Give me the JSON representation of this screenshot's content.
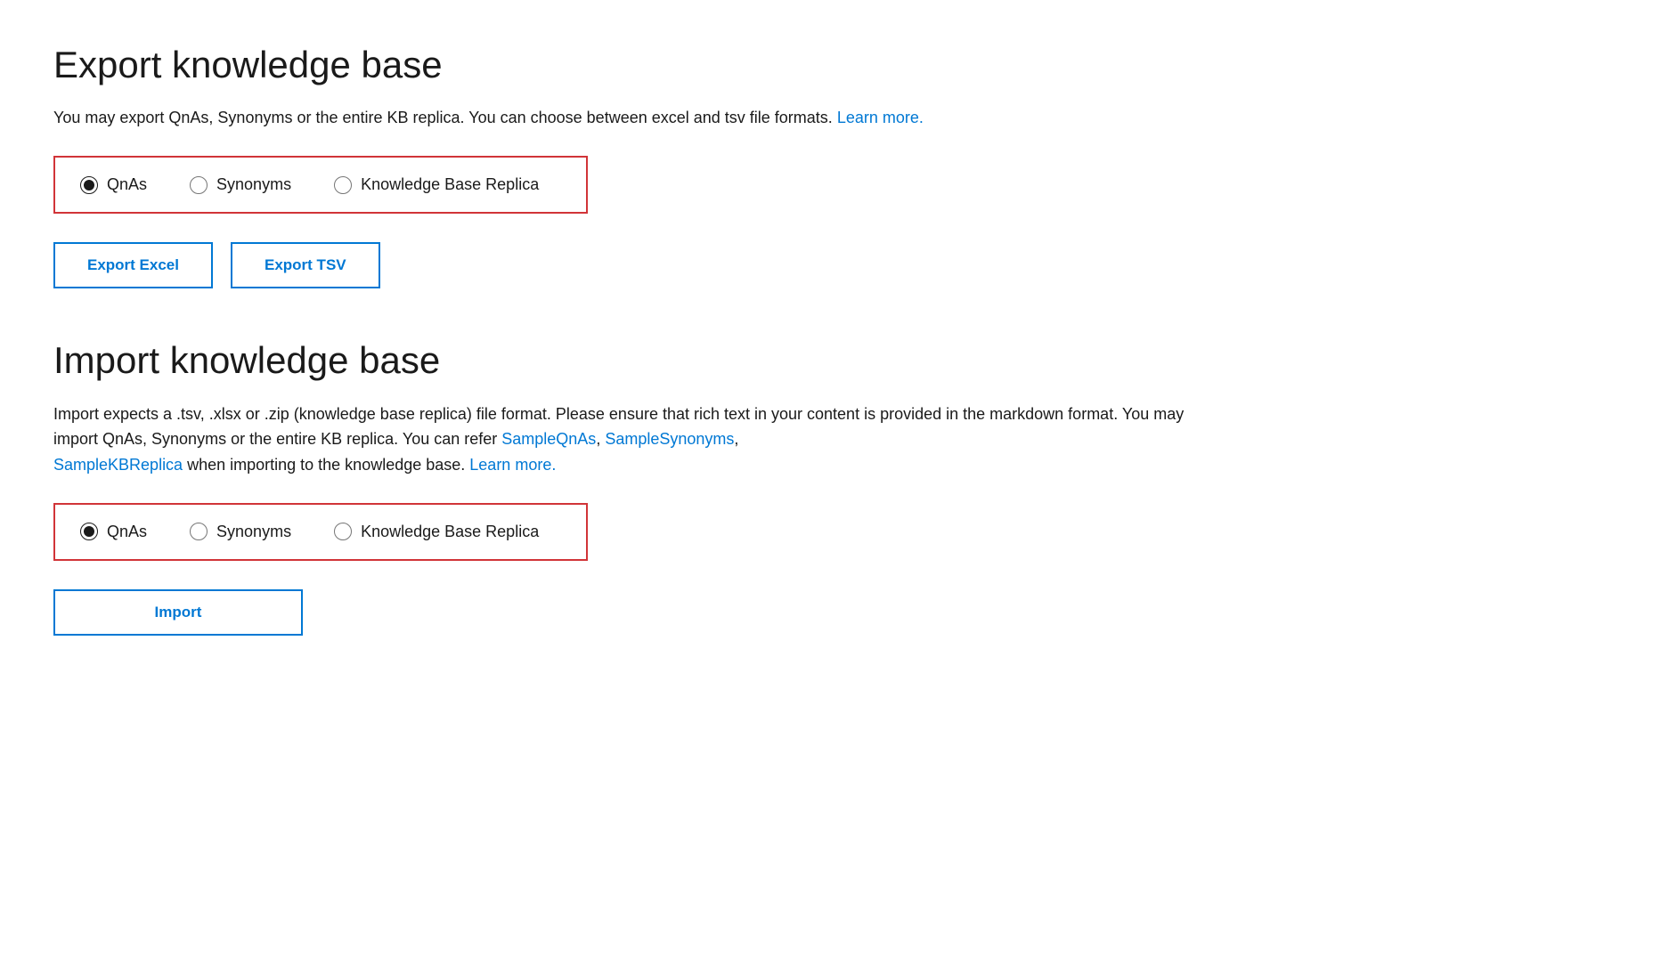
{
  "export_section": {
    "title": "Export knowledge base",
    "description_before_link": "You may export QnAs, Synonyms or the entire KB replica. You can choose between excel and tsv file formats.",
    "learn_more_label": "Learn more.",
    "learn_more_href": "#",
    "radio_group": {
      "options": [
        {
          "id": "export-qnas",
          "value": "qnas",
          "label": "QnAs",
          "checked": true
        },
        {
          "id": "export-synonyms",
          "value": "synonyms",
          "label": "Synonyms",
          "checked": false
        },
        {
          "id": "export-kbreplica",
          "value": "kbreplica",
          "label": "Knowledge Base Replica",
          "checked": false
        }
      ]
    },
    "buttons": [
      {
        "id": "btn-export-excel",
        "label": "Export Excel"
      },
      {
        "id": "btn-export-tsv",
        "label": "Export TSV"
      }
    ]
  },
  "import_section": {
    "title": "Import knowledge base",
    "description_line1": "Import expects a .tsv, .xlsx or .zip (knowledge base replica) file format. Please ensure that rich text in your content is provided in the",
    "description_line2": "markdown format. You may import QnAs, Synonyms or the entire KB replica. You can refer",
    "link_sample_qnas": "SampleQnAs",
    "link_sample_synonyms": "SampleSynonyms",
    "link_sample_kbreplica": "SampleKBReplica",
    "description_when_importing": "when importing to the knowledge base.",
    "learn_more_label": "Learn more.",
    "radio_group": {
      "options": [
        {
          "id": "import-qnas",
          "value": "qnas",
          "label": "QnAs",
          "checked": true
        },
        {
          "id": "import-synonyms",
          "value": "synonyms",
          "label": "Synonyms",
          "checked": false
        },
        {
          "id": "import-kbreplica",
          "value": "kbreplica",
          "label": "Knowledge Base Replica",
          "checked": false
        }
      ]
    },
    "import_button_label": "Import"
  }
}
